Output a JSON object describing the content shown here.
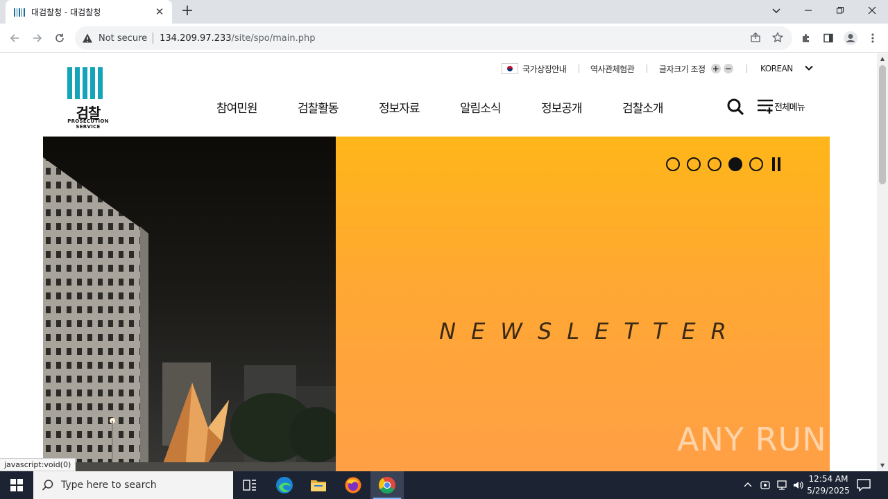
{
  "browser": {
    "tab_title": "대검찰청 - 대검찰청",
    "not_secure": "Not secure",
    "url_host": "134.209.97.233",
    "url_path": "/site/spo/main.php",
    "status_text": "javascript:void(0)"
  },
  "site": {
    "logo_ko": "검찰",
    "logo_en": "PROSECUTION SERVICE",
    "utility": {
      "national_symbols": "국가상징안내",
      "history_hall": "역사관체험관",
      "font_size": "글자크기 조정",
      "font_plus": "+",
      "font_minus": "−",
      "language": "KOREAN"
    },
    "nav": [
      "참여민원",
      "검찰활동",
      "정보자료",
      "알림소식",
      "정보공개",
      "검찰소개"
    ],
    "all_menu": "전체메뉴"
  },
  "hero": {
    "title": "NEWSLETTER",
    "slide_count": 5,
    "active_slide": 4
  },
  "watermark": "ANY RUN",
  "taskbar": {
    "search_placeholder": "Type here to search",
    "time": "12:54 AM",
    "date": "5/29/2025"
  },
  "colors": {
    "logo_teal": "#14a3b8",
    "hero_orange_top": "#ffb619",
    "hero_orange_bottom": "#ff9f47",
    "taskbar": "#1c2433"
  }
}
